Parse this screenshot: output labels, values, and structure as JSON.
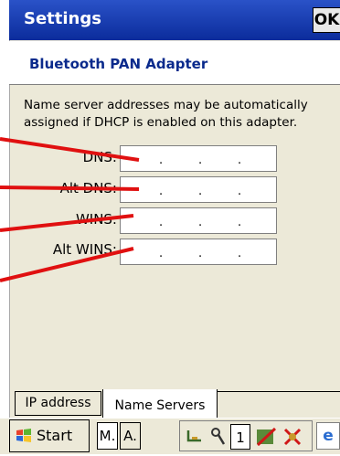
{
  "window": {
    "title": "Settings",
    "ok_label": "OK"
  },
  "header": {
    "adapter_title": "Bluetooth PAN Adapter"
  },
  "main": {
    "description": "Name server addresses may be automatically assigned if DHCP is enabled on this adapter.",
    "fields": [
      {
        "label": "DNS:",
        "value": ""
      },
      {
        "label": "Alt DNS:",
        "value": ""
      },
      {
        "label": "WINS:",
        "value": ""
      },
      {
        "label": "Alt WINS:",
        "value": ""
      }
    ],
    "ip_separator": "."
  },
  "tabs": [
    {
      "label": "IP address",
      "selected": false
    },
    {
      "label": "Name Servers",
      "selected": true
    }
  ],
  "taskbar": {
    "start_label": "Start",
    "buttons": [
      "M.",
      "A."
    ],
    "tray_icons": [
      "network-icon",
      "tools-icon",
      "one-icon",
      "pen-icon",
      "bluetooth-icon"
    ],
    "tray_one_label": "1",
    "corner_icon": "input-method-icon",
    "corner_label": "e"
  },
  "colors": {
    "titlebar": "#0b2c9c",
    "panel": "#ece9d8",
    "annotation": "#e01010",
    "adapter_title": "#0a2a8c"
  }
}
